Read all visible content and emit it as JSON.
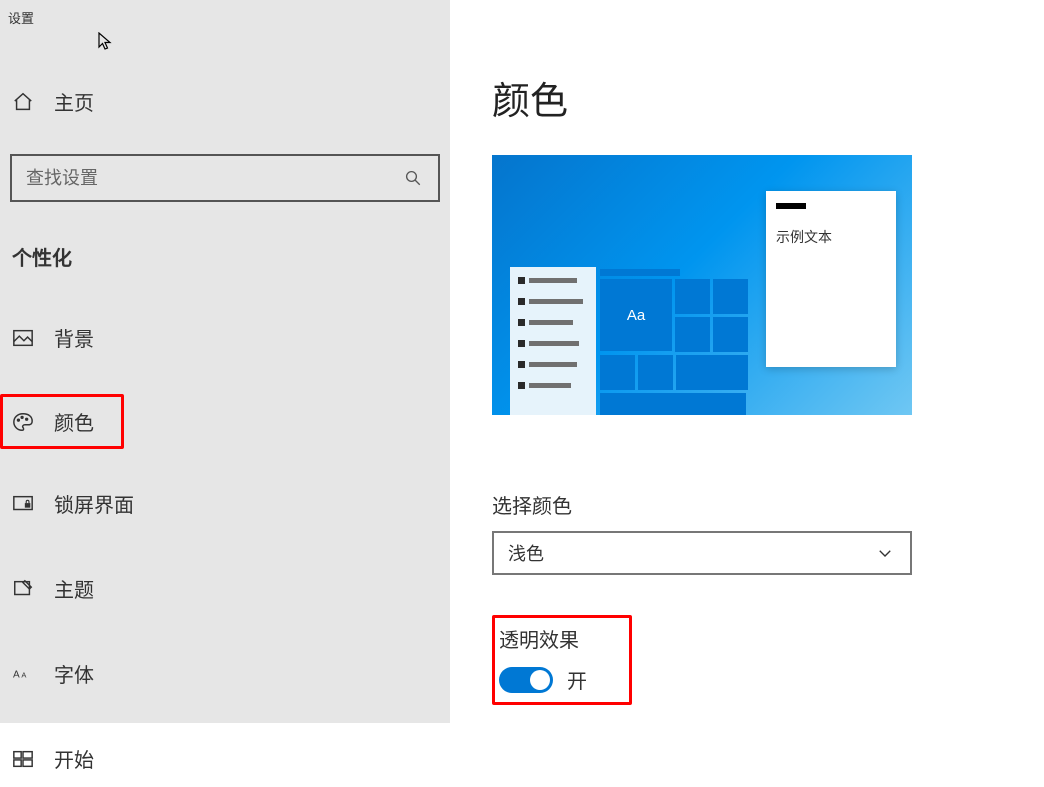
{
  "window": {
    "title": "设置"
  },
  "sidebar": {
    "home": "主页",
    "search_placeholder": "查找设置",
    "category": "个性化",
    "items": [
      {
        "label": "背景"
      },
      {
        "label": "颜色"
      },
      {
        "label": "锁屏界面"
      },
      {
        "label": "主题"
      },
      {
        "label": "字体"
      },
      {
        "label": "开始"
      }
    ]
  },
  "main": {
    "title": "颜色",
    "preview": {
      "sample_text": "示例文本",
      "tile_label": "Aa"
    },
    "choose_color": {
      "label": "选择颜色",
      "value": "浅色"
    },
    "transparency": {
      "label": "透明效果",
      "state": "开"
    }
  }
}
